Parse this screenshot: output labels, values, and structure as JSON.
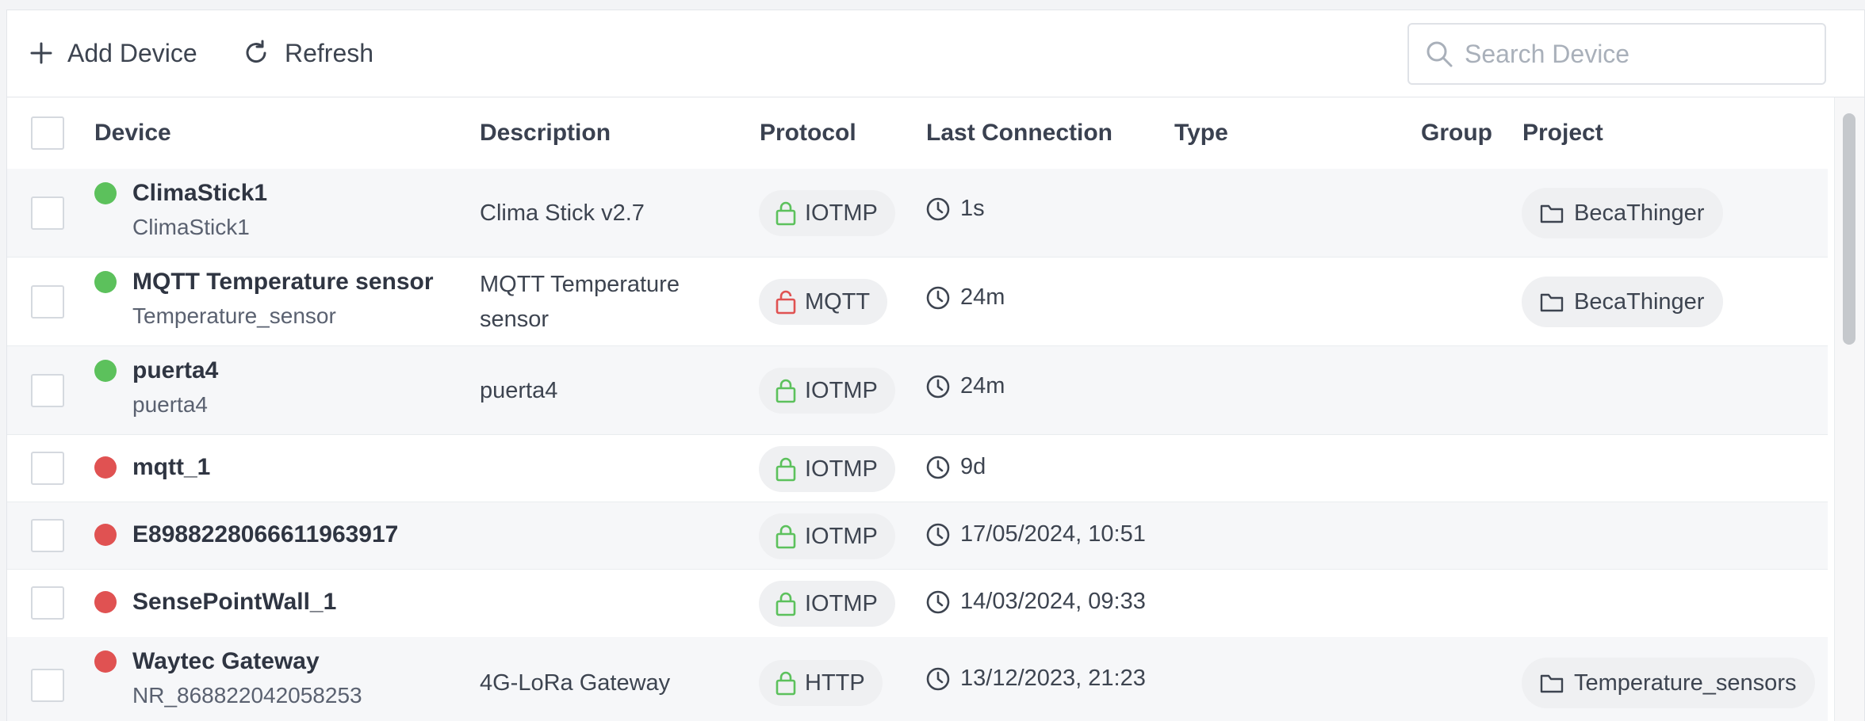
{
  "toolbar": {
    "add_label": "Add Device",
    "refresh_label": "Refresh",
    "search_placeholder": "Search Device"
  },
  "columns": {
    "device": "Device",
    "description": "Description",
    "protocol": "Protocol",
    "last_connection": "Last Connection",
    "type": "Type",
    "group": "Group",
    "project": "Project"
  },
  "colors": {
    "online": "#5cc15c",
    "offline": "#e05252",
    "secure_lock": "#5cc15c",
    "insecure_lock": "#e05252"
  },
  "rows": [
    {
      "name": "ClimaStick1",
      "id": "ClimaStick1",
      "status": "online",
      "description": "Clima Stick v2.7",
      "protocol": "IOTMP",
      "lock": "locked",
      "last_connection": "1s",
      "project": "BecaThinger"
    },
    {
      "name": "MQTT Temperature sensor",
      "id": "Temperature_sensor",
      "status": "online",
      "description": "MQTT Temperature sensor",
      "protocol": "MQTT",
      "lock": "unlocked",
      "last_connection": "24m",
      "project": "BecaThinger"
    },
    {
      "name": "puerta4",
      "id": "puerta4",
      "status": "online",
      "description": "puerta4",
      "protocol": "IOTMP",
      "lock": "locked",
      "last_connection": "24m",
      "project": ""
    },
    {
      "name": "mqtt_1",
      "id": "",
      "status": "offline",
      "description": "",
      "protocol": "IOTMP",
      "lock": "locked",
      "last_connection": "9d",
      "project": ""
    },
    {
      "name": "E8988228066611963917",
      "id": "",
      "status": "offline",
      "description": "",
      "protocol": "IOTMP",
      "lock": "locked",
      "last_connection": "17/05/2024, 10:51",
      "project": ""
    },
    {
      "name": "SensePointWall_1",
      "id": "",
      "status": "offline",
      "description": "",
      "protocol": "IOTMP",
      "lock": "locked",
      "last_connection": "14/03/2024, 09:33",
      "project": ""
    },
    {
      "name": "Waytec Gateway",
      "id": "NR_868822042058253",
      "status": "offline",
      "description": "4G-LoRa Gateway",
      "protocol": "HTTP",
      "lock": "locked",
      "last_connection": "13/12/2023, 21:23",
      "project": "Temperature_sensors"
    }
  ],
  "icons": {
    "add": "plus-icon",
    "refresh": "refresh-icon",
    "search": "search-icon",
    "protocol_locked": "lock-closed-icon",
    "protocol_unlocked": "lock-open-icon",
    "connection": "clock-icon",
    "project": "folder-icon"
  }
}
